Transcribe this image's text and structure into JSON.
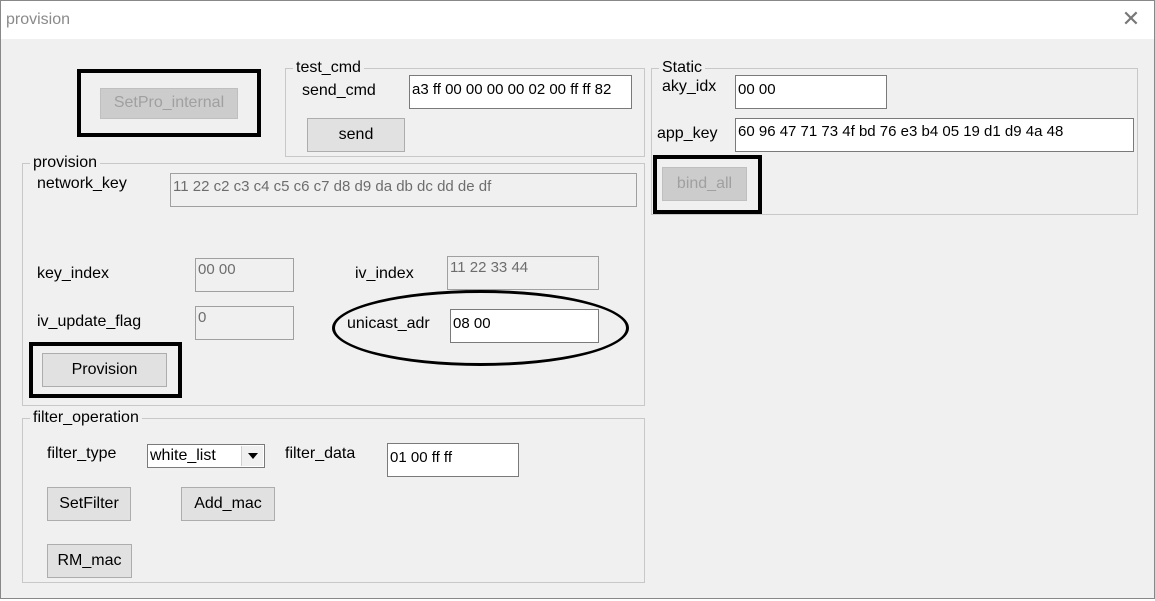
{
  "window": {
    "title": "provision",
    "close_glyph": "✕"
  },
  "setpro_button": "SetPro_internal",
  "test_cmd": {
    "title": "test_cmd",
    "send_cmd_label": "send_cmd",
    "send_cmd_value": "a3 ff 00 00 00 00 02 00 ff ff 82",
    "send_button": "send"
  },
  "static": {
    "title": "Static",
    "aky_idx_label": "aky_idx",
    "aky_idx_value": "00 00",
    "app_key_label": "app_key",
    "app_key_value": "60 96 47 71 73 4f bd 76 e3 b4 05 19 d1 d9 4a 48",
    "bind_all_button": "bind_all"
  },
  "provision": {
    "title": "provision",
    "network_key_label": "network_key",
    "network_key_value": "11 22 c2 c3 c4 c5 c6 c7 d8 d9 da db dc dd de df",
    "key_index_label": "key_index",
    "key_index_value": "00 00",
    "iv_index_label": "iv_index",
    "iv_index_value": "11 22 33 44",
    "iv_update_flag_label": "iv_update_flag",
    "iv_update_flag_value": "0",
    "unicast_adr_label": "unicast_adr",
    "unicast_adr_value": "08 00",
    "provision_button": "Provision"
  },
  "filter_operation": {
    "title": "filter_operation",
    "filter_type_label": "filter_type",
    "filter_type_value": "white_list",
    "filter_data_label": "filter_data",
    "filter_data_value": "01 00 ff ff",
    "setfilter_button": "SetFilter",
    "add_mac_button": "Add_mac",
    "rm_mac_button": "RM_mac"
  }
}
